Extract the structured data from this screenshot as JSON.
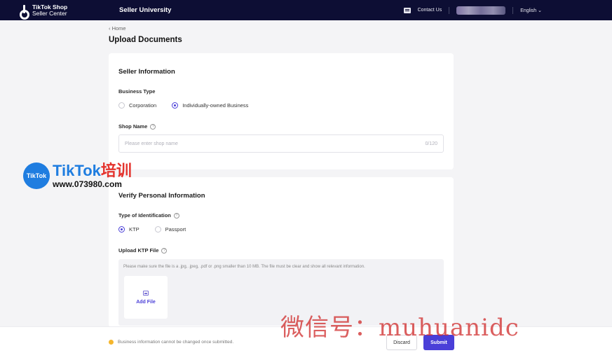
{
  "nav": {
    "logo_line1": "TikTok Shop",
    "logo_line2": "Seller Center",
    "title": "Seller University",
    "contact": "Contact Us",
    "language": "English ⌄"
  },
  "breadcrumb": "‹ Home",
  "page_title": "Upload Documents",
  "seller_info": {
    "title": "Seller Information",
    "business_type_label": "Business Type",
    "business_types": [
      "Corporation",
      "Individually-owned Business"
    ],
    "selected_business_type": "Individually-owned Business",
    "shop_name_label": "Shop Name",
    "shop_name_placeholder": "Please enter shop name",
    "shop_name_counter": "0/120"
  },
  "verify": {
    "title": "Verify Personal Information",
    "id_type_label": "Type of Identification",
    "id_types": [
      "KTP",
      "Passport"
    ],
    "selected_id_type": "KTP",
    "upload_label": "Upload KTP File",
    "upload_hint": "Please make sure the file is a .jpg, .jpeg, .pdf or .png smaller than 10 MB. The file must be clear and show all relevant information.",
    "add_file": "Add File"
  },
  "footer": {
    "note": "Business information cannot be changed once submitted.",
    "discard": "Discard",
    "submit": "Submit"
  },
  "watermark": {
    "badge": "TikTok",
    "title_blue": "TikTok",
    "title_red": "培训",
    "url": "www.073980.com",
    "bottom": "微信号：muhuanidc"
  },
  "colors": {
    "primary": "#4a3fd8",
    "nav_bg": "#0d0e34"
  }
}
